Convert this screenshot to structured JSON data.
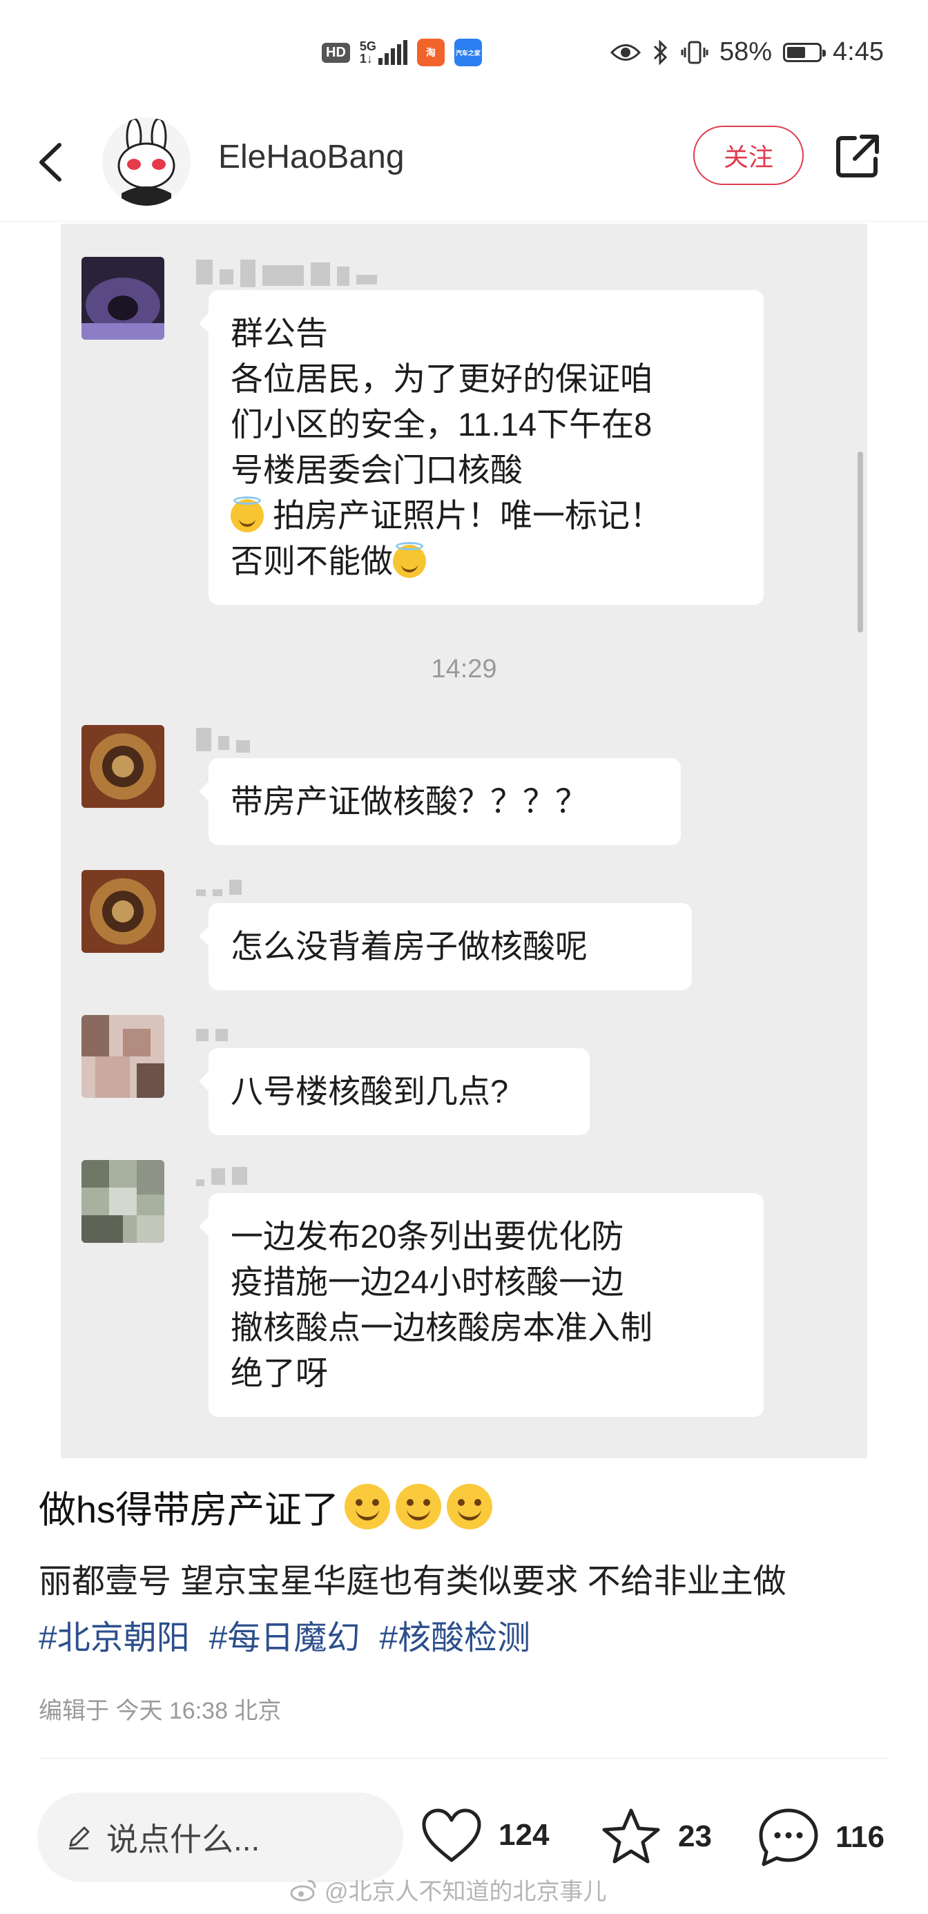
{
  "status_bar": {
    "hd": "HD",
    "network": "5G",
    "network_sub": "1↓",
    "app1": "淘",
    "app2": "汽车之家",
    "battery": "58%",
    "battery_level": 0.58,
    "time": "4:45"
  },
  "header": {
    "username": "EleHaoBang",
    "follow_label": "关注"
  },
  "chat": {
    "messages": [
      {
        "lines": [
          "群公告",
          "各位居民，为了更好的保证咱",
          "们小区的安全，11.14下午在8",
          "号楼居委会门口核酸"
        ],
        "line5": "拍房产证照片！唯一标记！",
        "line6": "否则不能做"
      },
      {
        "lines": [
          "带房产证做核酸？？？？"
        ]
      },
      {
        "lines": [
          "怎么没背着房子做核酸呢"
        ]
      },
      {
        "lines": [
          "八号楼核酸到几点?"
        ]
      },
      {
        "lines": [
          "一边发布20条列出要优化防",
          "疫措施一边24小时核酸一边",
          "撤核酸点一边核酸房本准入制",
          "绝了呀"
        ]
      }
    ],
    "time_divider": "14:29"
  },
  "post": {
    "title": "做hs得带房产证了",
    "body": "丽都壹号 望京宝星华庭也有类似要求 不给非业主做",
    "tags": [
      "#北京朝阳",
      "#每日魔幻",
      "#核酸检测"
    ],
    "edit_time": "编辑于 今天 16:38 北京"
  },
  "bottom_bar": {
    "comment_placeholder": "说点什么...",
    "likes": "124",
    "favorites": "23",
    "comments": "116"
  },
  "watermark": "@北京人不知道的北京事儿",
  "colors": {
    "accent": "#e03c4e",
    "tag": "#2c4f8c",
    "chat_bg": "#ededed"
  }
}
